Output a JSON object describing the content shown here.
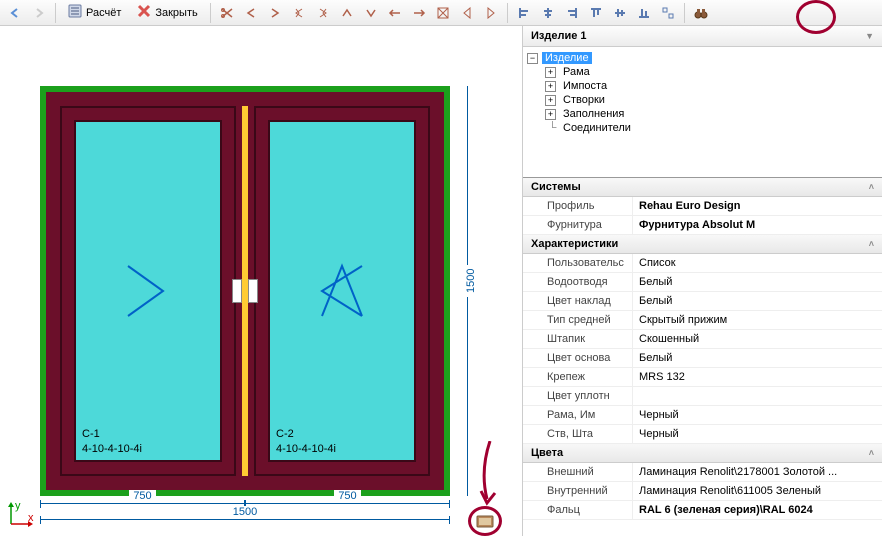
{
  "toolbar": {
    "back_icon": "arrow-left",
    "forward_icon": "arrow-right",
    "calc_label": "Расчёт",
    "close_label": "Закрыть"
  },
  "tree": {
    "header": "Изделие 1",
    "root": "Изделие",
    "nodes": [
      "Рама",
      "Импоста",
      "Створки",
      "Заполнения",
      "Соединители"
    ]
  },
  "drawing": {
    "sash1_code": "C-1",
    "sash1_formula": "4-10-4-10-4і",
    "sash2_code": "C-2",
    "sash2_formula": "4-10-4-10-4і",
    "dim_half": "750",
    "dim_full": "1500",
    "dim_height": "1500"
  },
  "props": {
    "sections": {
      "systems": "Системы",
      "chars": "Характеристики",
      "colors": "Цвета"
    },
    "systems": [
      {
        "k": "Профиль",
        "v": "Rehau Euro Design",
        "bold": true
      },
      {
        "k": "Фурнитура",
        "v": "Фурнитура Absolut M",
        "bold": true
      }
    ],
    "chars": [
      {
        "k": "Пользовательс",
        "v": "Список"
      },
      {
        "k": "Водоотводя",
        "v": "Белый"
      },
      {
        "k": "Цвет наклад",
        "v": "Белый"
      },
      {
        "k": "Тип средней",
        "v": "Скрытый прижим"
      },
      {
        "k": "Штапик",
        "v": "Скошенный"
      },
      {
        "k": "Цвет основа",
        "v": "Белый"
      },
      {
        "k": "Крепеж",
        "v": "MRS 132"
      },
      {
        "k": "Цвет уплотн",
        "v": ""
      },
      {
        "k": "Рама, Им",
        "v": "Черный"
      },
      {
        "k": "Ств, Шта",
        "v": "Черный"
      }
    ],
    "colors": [
      {
        "k": "Внешний",
        "v": "Ламинация Renolit\\2178001 Золотой ..."
      },
      {
        "k": "Внутренний",
        "v": "Ламинация Renolit\\611005 Зеленый"
      },
      {
        "k": "Фальц",
        "v": "RAL 6 (зеленая серия)\\RAL 6024",
        "bold": true
      }
    ]
  }
}
